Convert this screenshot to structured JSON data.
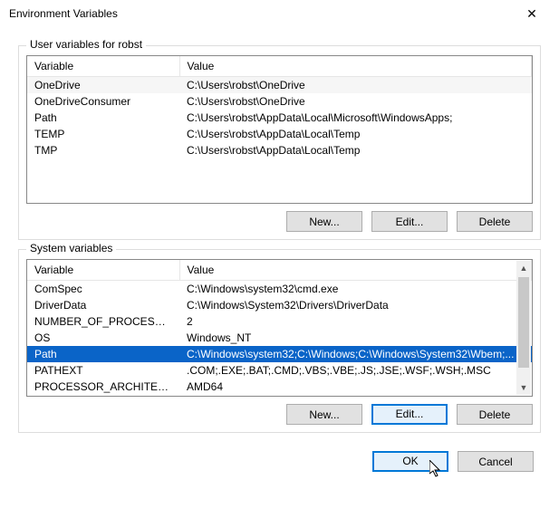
{
  "title": "Environment Variables",
  "user_section": {
    "label": "User variables for robst",
    "headers": {
      "variable": "Variable",
      "value": "Value"
    },
    "rows": [
      {
        "variable": "OneDrive",
        "value": "C:\\Users\\robst\\OneDrive"
      },
      {
        "variable": "OneDriveConsumer",
        "value": "C:\\Users\\robst\\OneDrive"
      },
      {
        "variable": "Path",
        "value": "C:\\Users\\robst\\AppData\\Local\\Microsoft\\WindowsApps;"
      },
      {
        "variable": "TEMP",
        "value": "C:\\Users\\robst\\AppData\\Local\\Temp"
      },
      {
        "variable": "TMP",
        "value": "C:\\Users\\robst\\AppData\\Local\\Temp"
      }
    ],
    "buttons": {
      "new": "New...",
      "edit": "Edit...",
      "delete": "Delete"
    }
  },
  "system_section": {
    "label": "System variables",
    "headers": {
      "variable": "Variable",
      "value": "Value"
    },
    "rows": [
      {
        "variable": "ComSpec",
        "value": "C:\\Windows\\system32\\cmd.exe"
      },
      {
        "variable": "DriverData",
        "value": "C:\\Windows\\System32\\Drivers\\DriverData"
      },
      {
        "variable": "NUMBER_OF_PROCESSORS",
        "value": "2"
      },
      {
        "variable": "OS",
        "value": "Windows_NT"
      },
      {
        "variable": "Path",
        "value": "C:\\Windows\\system32;C:\\Windows;C:\\Windows\\System32\\Wbem;..."
      },
      {
        "variable": "PATHEXT",
        "value": ".COM;.EXE;.BAT;.CMD;.VBS;.VBE;.JS;.JSE;.WSF;.WSH;.MSC"
      },
      {
        "variable": "PROCESSOR_ARCHITECTURE",
        "value": "AMD64"
      }
    ],
    "selected_index": 4,
    "buttons": {
      "new": "New...",
      "edit": "Edit...",
      "delete": "Delete"
    }
  },
  "dialog_buttons": {
    "ok": "OK",
    "cancel": "Cancel"
  }
}
